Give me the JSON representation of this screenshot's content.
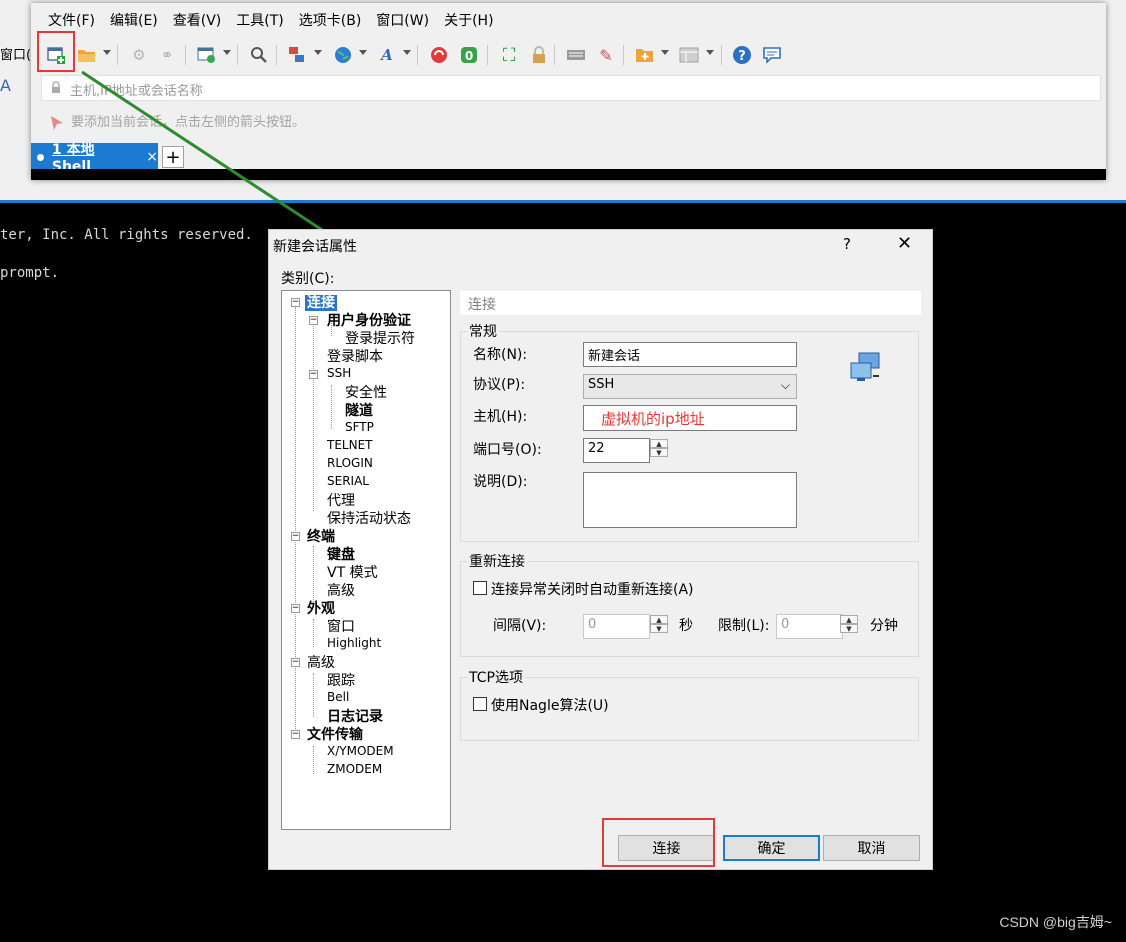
{
  "menubar": {
    "items": [
      "文件(F)",
      "编辑(E)",
      "查看(V)",
      "工具(T)",
      "选项卡(B)",
      "窗口(W)",
      "关于(H)"
    ]
  },
  "background": {
    "side_text": "窗口(",
    "term_line1": "ter, Inc. All rights reserved.",
    "term_line2": "prompt."
  },
  "address_bar": {
    "placeholder": "主机,IP地址或会话名称"
  },
  "hint_bar": {
    "text": "要添加当前会话，点击左侧的箭头按钮。"
  },
  "tabs": [
    {
      "label": "1 本地Shell",
      "close": "×"
    }
  ],
  "tab_add": "+",
  "dialog": {
    "title": "新建会话属性",
    "help": "?",
    "close": "✕",
    "category_label": "类别(C):",
    "tree": [
      "连接",
      "用户身份验证",
      "登录提示符",
      "登录脚本",
      "SSH",
      "安全性",
      "隧道",
      "SFTP",
      "TELNET",
      "RLOGIN",
      "SERIAL",
      "代理",
      "保持活动状态",
      "终端",
      "键盘",
      "VT 模式",
      "高级",
      "外观",
      "窗口",
      "Highlight",
      "高级",
      "跟踪",
      "Bell",
      "日志记录",
      "文件传输",
      "X/YMODEM",
      "ZMODEM"
    ],
    "panel_header": "连接",
    "general": {
      "title": "常规",
      "name_label": "名称(N):",
      "name_value": "新建会话",
      "protocol_label": "协议(P):",
      "protocol_value": "SSH",
      "host_label": "主机(H):",
      "host_value": "虚拟机的ip地址",
      "port_label": "端口号(O):",
      "port_value": "22",
      "desc_label": "说明(D):"
    },
    "reconnect": {
      "title": "重新连接",
      "auto_label": "连接异常关闭时自动重新连接(A)",
      "interval_label": "间隔(V):",
      "interval_value": "0",
      "sec": "秒",
      "limit_label": "限制(L):",
      "limit_value": "0",
      "min": "分钟"
    },
    "tcp": {
      "title": "TCP选项",
      "nagle_label": "使用Nagle算法(U)"
    },
    "buttons": {
      "connect": "连接",
      "ok": "确定",
      "cancel": "取消"
    }
  },
  "watermark": "CSDN @big吉姆~",
  "colors": {
    "accent": "#1c7ad1",
    "highlight_red": "#e53935",
    "arrow_green": "#2e8b2e"
  }
}
